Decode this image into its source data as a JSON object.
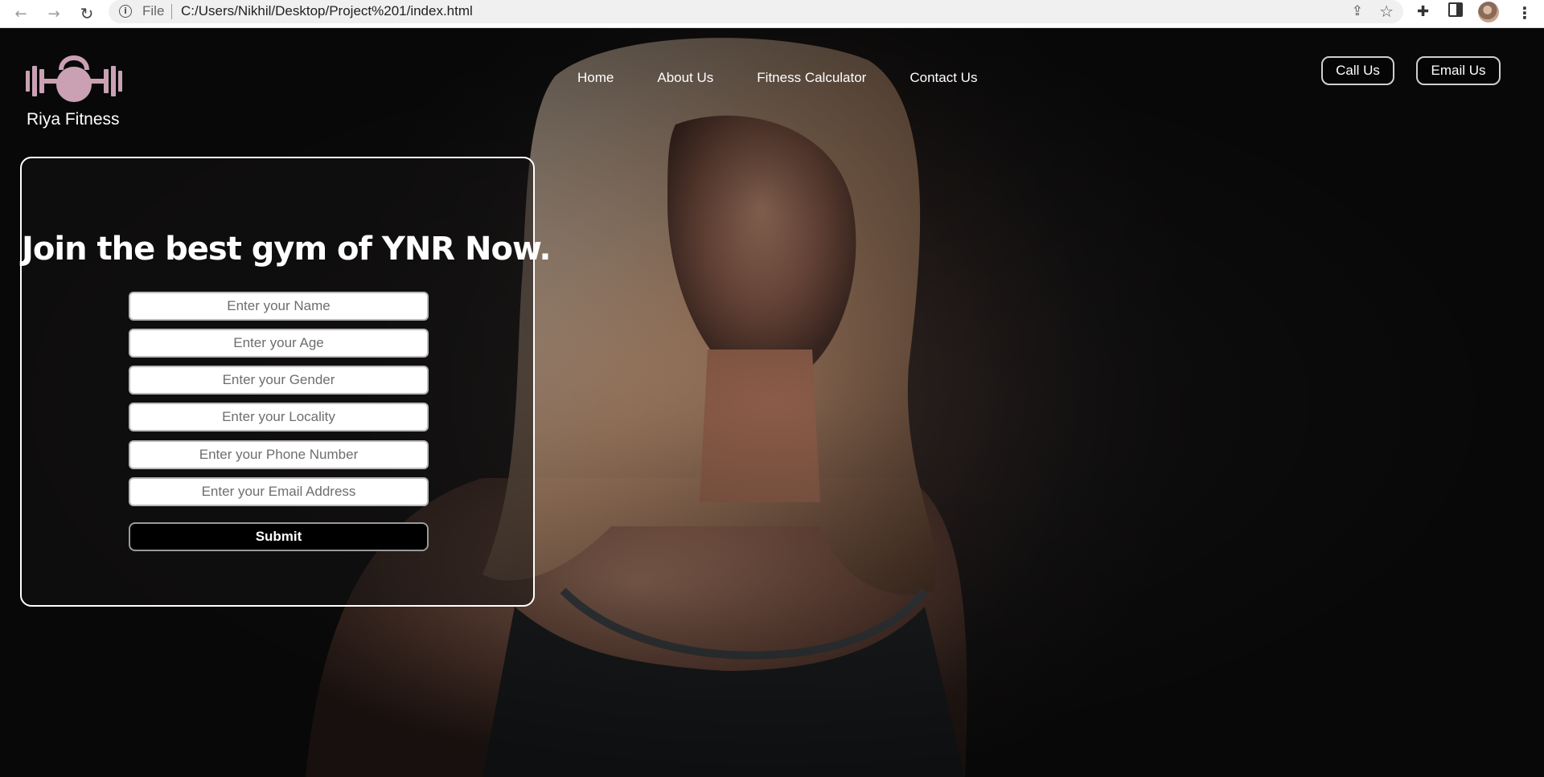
{
  "browser": {
    "file_label": "File",
    "url": "C:/Users/Nikhil/Desktop/Project%201/index.html"
  },
  "site": {
    "brand": "Riya Fitness",
    "nav": [
      "Home",
      "About Us",
      "Fitness Calculator",
      "Contact Us"
    ],
    "cta": {
      "call": "Call Us",
      "email": "Email Us"
    },
    "logo_color": "#c9a1b3"
  },
  "form": {
    "title": "Join the best gym of YNR Now.",
    "fields": [
      {
        "placeholder": "Enter your Name",
        "value": ""
      },
      {
        "placeholder": "Enter your Age",
        "value": ""
      },
      {
        "placeholder": "Enter your Gender",
        "value": ""
      },
      {
        "placeholder": "Enter your Locality",
        "value": ""
      },
      {
        "placeholder": "Enter your Phone Number",
        "value": ""
      },
      {
        "placeholder": "Enter your Email Address",
        "value": ""
      }
    ],
    "submit": "Submit"
  },
  "icons": {
    "back": "arrow-left-icon",
    "forward": "arrow-right-icon",
    "reload": "reload-icon",
    "info": "info-icon",
    "share": "share-icon",
    "bookmark": "star-icon",
    "extensions": "puzzle-icon",
    "side_panel": "side-panel-icon",
    "profile": "avatar",
    "menu": "kebab-menu-icon"
  }
}
